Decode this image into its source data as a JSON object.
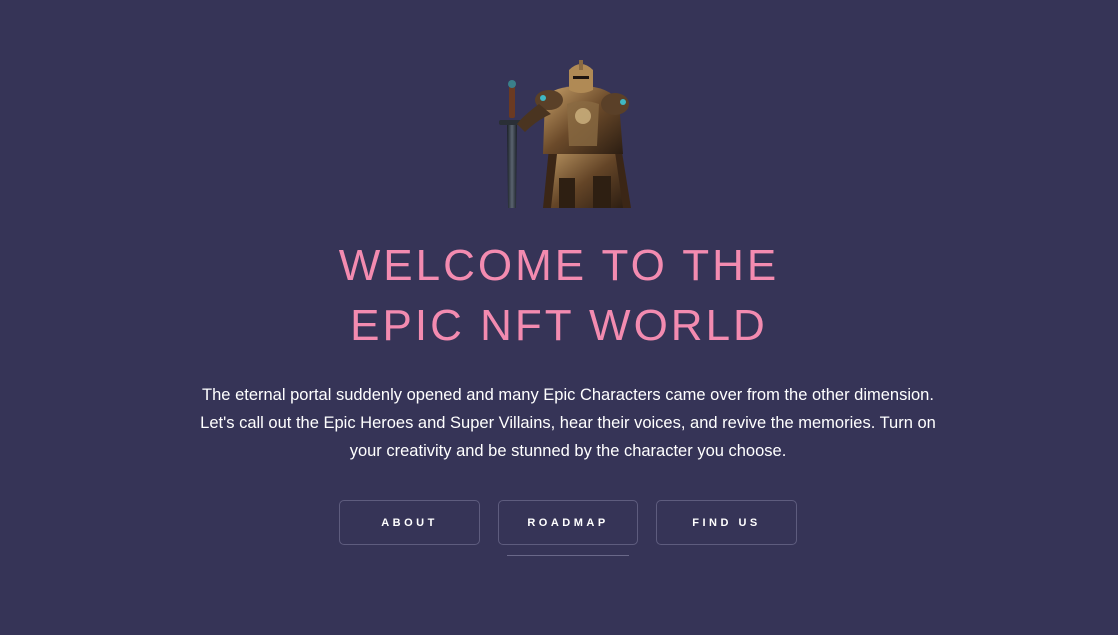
{
  "hero": {
    "image_icon": "armored-knight-with-sword",
    "title_line1": "WELCOME TO THE",
    "title_line2": "EPIC NFT WORLD",
    "description": "The eternal portal suddenly opened and many Epic Characters came over from the other dimension. Let's call out the Epic Heroes and Super Villains, hear their voices, and revive the memories. Turn on your creativity and be stunned by the character you choose."
  },
  "nav": {
    "about_label": "ABOUT",
    "roadmap_label": "ROADMAP",
    "find_us_label": "FIND US"
  },
  "colors": {
    "background": "#363457",
    "title": "#f38bb0",
    "text": "#ffffff",
    "button_border": "#5e5c7e"
  }
}
